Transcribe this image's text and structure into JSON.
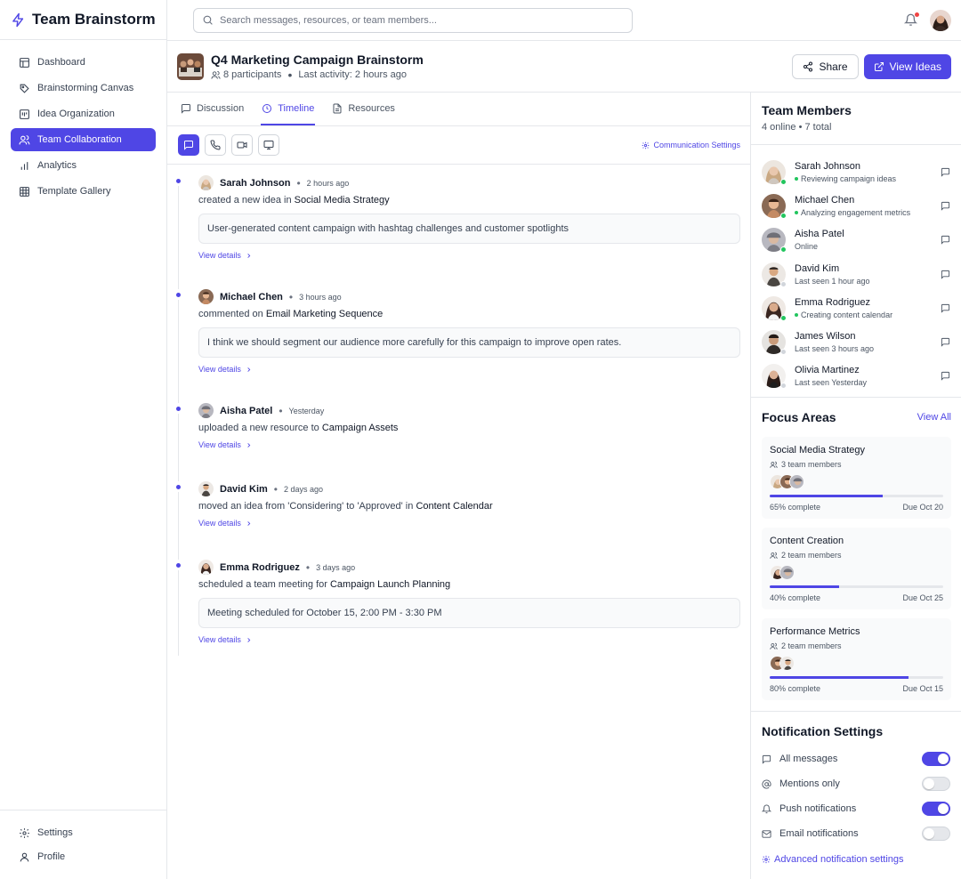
{
  "app": {
    "name": "Team Brainstorm"
  },
  "nav": {
    "items": [
      {
        "label": "Dashboard",
        "icon": "dashboard-icon"
      },
      {
        "label": "Brainstorming Canvas",
        "icon": "palette-icon"
      },
      {
        "label": "Idea Organization",
        "icon": "kanban-icon"
      },
      {
        "label": "Team Collaboration",
        "icon": "users-icon",
        "active": true
      },
      {
        "label": "Analytics",
        "icon": "bar-chart-icon"
      },
      {
        "label": "Template Gallery",
        "icon": "grid-icon"
      }
    ],
    "bottom": [
      {
        "label": "Settings",
        "icon": "gear-icon"
      },
      {
        "label": "Profile",
        "icon": "user-icon"
      }
    ]
  },
  "search": {
    "placeholder": "Search messages, resources, or team members..."
  },
  "project": {
    "title": "Q4 Marketing Campaign Brainstorm",
    "participants": "8 participants",
    "last_activity": "Last activity: 2 hours ago",
    "share_label": "Share",
    "view_ideas_label": "View Ideas"
  },
  "tabs": [
    {
      "label": "Discussion"
    },
    {
      "label": "Timeline",
      "active": true
    },
    {
      "label": "Resources"
    }
  ],
  "toolbar": {
    "communication_settings": "Communication Settings"
  },
  "timeline": [
    {
      "name": "Sarah Johnson",
      "time": "2 hours ago",
      "action": "created a new idea in",
      "target": "Social Media Strategy",
      "detail": "User-generated content campaign with hashtag challenges and customer spotlights",
      "link": "View details"
    },
    {
      "name": "Michael Chen",
      "time": "3 hours ago",
      "action": "commented on",
      "target": "Email Marketing Sequence",
      "detail": "I think we should segment our audience more carefully for this campaign to improve open rates.",
      "link": "View details"
    },
    {
      "name": "Aisha Patel",
      "time": "Yesterday",
      "action": "uploaded a new resource to",
      "target": "Campaign Assets",
      "detail": "",
      "link": "View details"
    },
    {
      "name": "David Kim",
      "time": "2 days ago",
      "action": "moved an idea from 'Considering' to 'Approved' in",
      "target": "Content Calendar",
      "detail": "",
      "link": "View details"
    },
    {
      "name": "Emma Rodriguez",
      "time": "3 days ago",
      "action": "scheduled a team meeting for",
      "target": "Campaign Launch Planning",
      "detail": "Meeting scheduled for October 15, 2:00 PM - 3:30 PM",
      "link": "View details"
    }
  ],
  "team": {
    "title": "Team Members",
    "summary": "4 online • 7 total",
    "members": [
      {
        "name": "Sarah Johnson",
        "activity": "Reviewing campaign ideas",
        "online": true
      },
      {
        "name": "Michael Chen",
        "activity": "Analyzing engagement metrics",
        "online": true
      },
      {
        "name": "Aisha Patel",
        "activity": "Online",
        "online": true
      },
      {
        "name": "David Kim",
        "activity": "Last seen 1 hour ago",
        "online": false
      },
      {
        "name": "Emma Rodriguez",
        "activity": "Creating content calendar",
        "online": true
      },
      {
        "name": "James Wilson",
        "activity": "Last seen 3 hours ago",
        "online": false
      },
      {
        "name": "Olivia Martinez",
        "activity": "Last seen Yesterday",
        "online": false
      }
    ]
  },
  "focus": {
    "title": "Focus Areas",
    "view_all": "View All",
    "areas": [
      {
        "name": "Social Media Strategy",
        "members": "3 team members",
        "avatars": 3,
        "progress": 65,
        "progress_label": "65% complete",
        "due": "Due Oct 20"
      },
      {
        "name": "Content Creation",
        "members": "2 team members",
        "avatars": 2,
        "progress": 40,
        "progress_label": "40% complete",
        "due": "Due Oct 25"
      },
      {
        "name": "Performance Metrics",
        "members": "2 team members",
        "avatars": 2,
        "progress": 80,
        "progress_label": "80% complete",
        "due": "Due Oct 15"
      }
    ]
  },
  "notifications": {
    "title": "Notification Settings",
    "items": [
      {
        "label": "All messages",
        "icon": "message-icon",
        "on": true
      },
      {
        "label": "Mentions only",
        "icon": "at-sign-icon",
        "on": false
      },
      {
        "label": "Push notifications",
        "icon": "bell-icon",
        "on": true
      },
      {
        "label": "Email notifications",
        "icon": "mail-icon",
        "on": false
      }
    ],
    "advanced": "Advanced notification settings"
  },
  "colors": {
    "accent": "#4f46e5",
    "online": "#22c55e",
    "offline": "#d1d5db"
  }
}
